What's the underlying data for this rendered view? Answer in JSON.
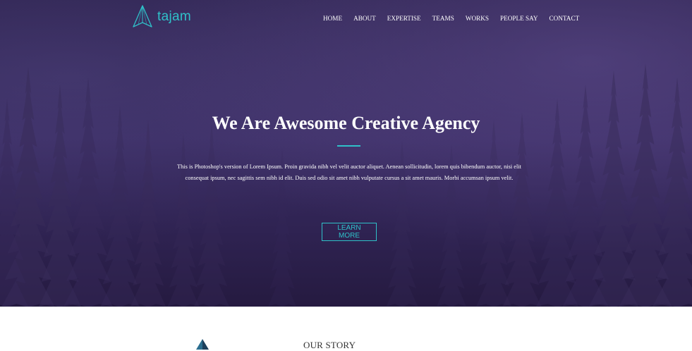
{
  "brand": {
    "name": "tajam",
    "accent_color": "#2fc1c9",
    "logo_icon": "pyramid-logo-icon"
  },
  "nav": {
    "items": [
      {
        "label": "HOME"
      },
      {
        "label": "ABOUT"
      },
      {
        "label": "EXPERTISE"
      },
      {
        "label": "TEAMS"
      },
      {
        "label": "WORKS"
      },
      {
        "label": "PEOPLE SAY"
      },
      {
        "label": "CONTACT"
      }
    ]
  },
  "hero": {
    "headline": "We Are Awesome Creative Agency",
    "text": "This is Photoshop's version of Lorem Ipsum. Proin gravida nibh vel velit auctor aliquet. Aenean sollicitudin, lorem quis bibendum auctor, nisi elit consequat ipsum, nec sagittis sem nibh id elit. Duis sed odio sit amet nibh vulputate cursus a sit amet mauris. Morbi accumsan ipsum velit.",
    "cta_label": "LEARN MORE",
    "background_color": "#2e2350",
    "background_image": "misty-forest-trees"
  },
  "story": {
    "title": "OUR STORY",
    "icon": "pyramid-icon"
  }
}
